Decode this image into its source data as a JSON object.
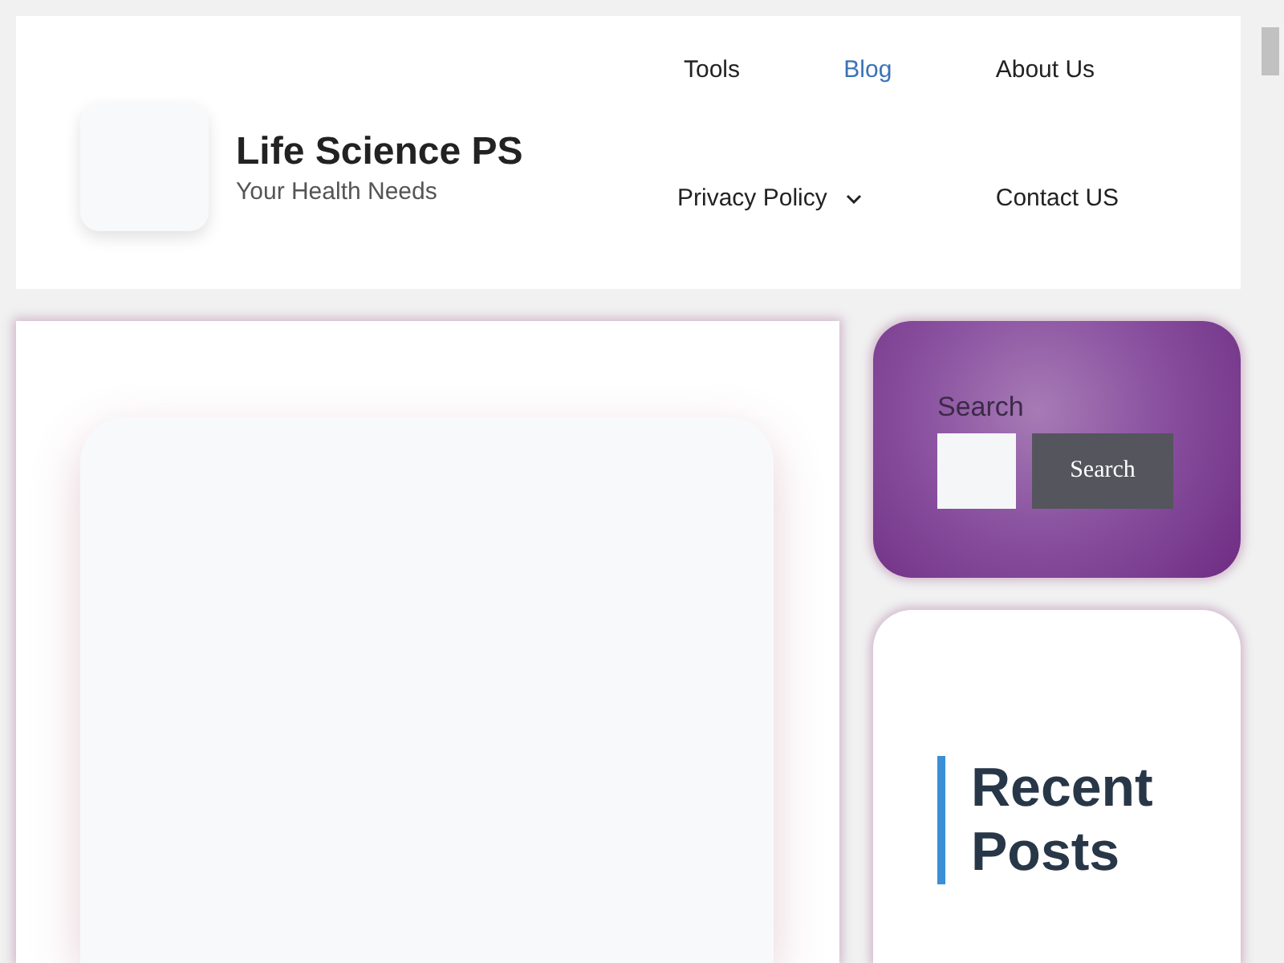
{
  "site": {
    "title": "Life Science PS",
    "tagline": "Your Health Needs"
  },
  "nav": [
    {
      "label": "Tools",
      "selected": false,
      "has_submenu": false
    },
    {
      "label": "Blog",
      "selected": true,
      "has_submenu": false
    },
    {
      "label": "About Us",
      "selected": false,
      "has_submenu": false
    },
    {
      "label": "Privacy Policy",
      "selected": false,
      "has_submenu": true
    },
    {
      "label": "Contact US",
      "selected": false,
      "has_submenu": false
    }
  ],
  "search_widget": {
    "label": "Search",
    "button": "Search"
  },
  "recent_posts": {
    "heading": "Recent Posts"
  }
}
